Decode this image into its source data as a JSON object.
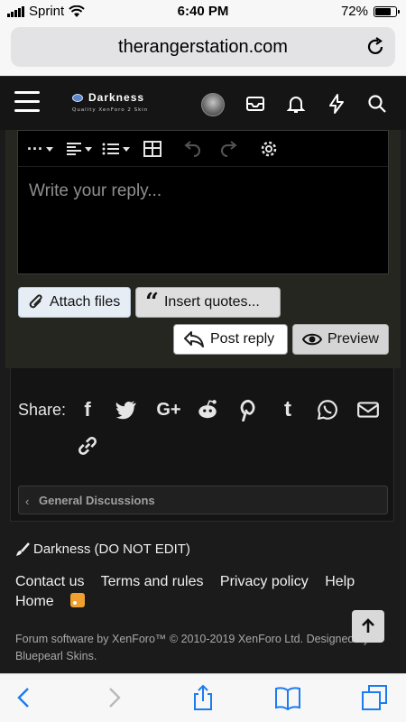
{
  "status_bar": {
    "carrier": "Sprint",
    "time": "6:40 PM",
    "battery": "72%"
  },
  "browser": {
    "url": "therangerstation.com"
  },
  "site_header": {
    "logo_name": "Darkness",
    "logo_tagline": "Quality XenForo 2 Skin"
  },
  "editor": {
    "placeholder": "Write your reply..."
  },
  "buttons": {
    "attach": "Attach files",
    "insert_quotes": "Insert quotes...",
    "post_reply": "Post reply",
    "preview": "Preview"
  },
  "share": {
    "label": "Share:"
  },
  "breadcrumb": {
    "label": "General Discussions"
  },
  "footer": {
    "style_chooser": "Darkness (DO NOT EDIT)",
    "links": [
      "Contact us",
      "Terms and rules",
      "Privacy policy",
      "Help",
      "Home"
    ],
    "copyright": "Forum software by XenForo™ © 2010-2019 XenForo Ltd. Designed by Bluepearl Skins."
  },
  "colors": {
    "background": "#1b1b1b",
    "panel": "#262620",
    "editor": "#000000",
    "accent_rss": "#f0a030"
  }
}
